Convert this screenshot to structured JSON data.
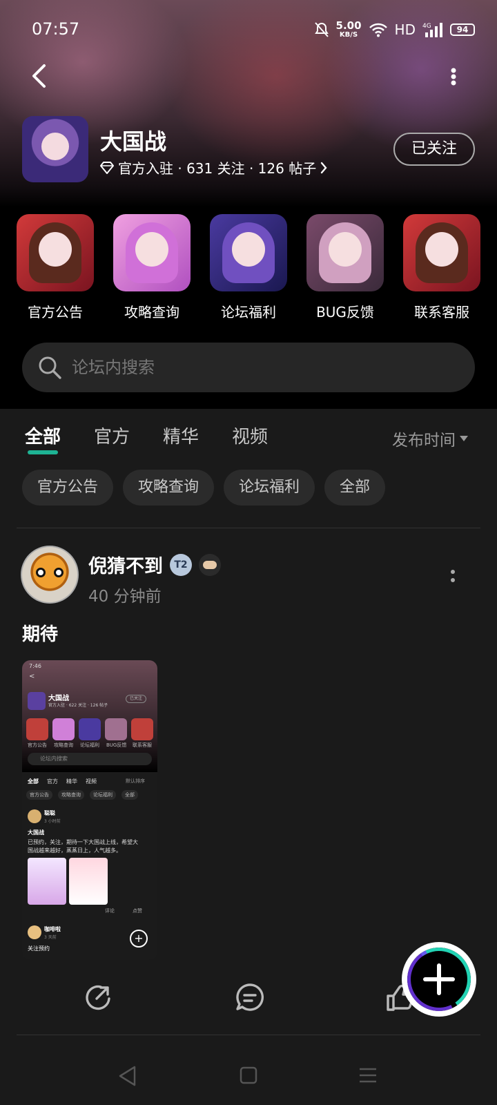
{
  "status_bar": {
    "time": "07:57",
    "net_speed_value": "5.00",
    "net_speed_unit": "KB/S",
    "hd": "HD",
    "network": "4G",
    "battery": "94"
  },
  "forum": {
    "title": "大国战",
    "meta": "官方入驻 · 631 关注 · 126 帖子",
    "follow_label": "已关注"
  },
  "shortcuts": [
    {
      "label": "官方公告",
      "icon": "forum-announcement-image"
    },
    {
      "label": "攻略查询",
      "icon": "strategy-image"
    },
    {
      "label": "论坛福利",
      "icon": "welfare-image"
    },
    {
      "label": "BUG反馈",
      "icon": "bug-feedback-image"
    },
    {
      "label": "联系客服",
      "icon": "customer-service-image"
    }
  ],
  "search": {
    "placeholder": "论坛内搜索"
  },
  "tabs": [
    {
      "label": "全部",
      "active": true
    },
    {
      "label": "官方",
      "active": false
    },
    {
      "label": "精华",
      "active": false
    },
    {
      "label": "视频",
      "active": false
    }
  ],
  "sort_label": "发布时间",
  "chips": [
    "官方公告",
    "攻略查询",
    "论坛福利",
    "全部"
  ],
  "post": {
    "author": "倪猜不到",
    "level_badge": "T2",
    "time": "40 分钟前",
    "content": "期待"
  },
  "thumbnail": {
    "time": "7:46",
    "title": "大国战",
    "meta": "官方入驻 · 622 关注 · 126 帖子",
    "follow": "已关注",
    "labels": [
      "官方公告",
      "攻略查询",
      "论坛福利",
      "BUG反馈",
      "联系客服"
    ],
    "search": "论坛内搜索",
    "tabs": [
      "全部",
      "官方",
      "精华",
      "视频"
    ],
    "sort": "默认排序",
    "chips": [
      "官方公告",
      "攻略查询",
      "论坛福利",
      "全部"
    ],
    "author": "聪聪",
    "author_time": "3 小时前",
    "post_title": "大国战",
    "post_text_1": "已预约，关注，期待一下大国战上线，希望大",
    "post_text_2": "国战越来越好，蒸蒸日上，人气越多。",
    "comment": "评论",
    "like": "点赞",
    "author2": "咖啡啦",
    "author2_time": "3 天前",
    "post2": "关注预约"
  },
  "colors": {
    "accent": "#1fc4a2",
    "background": "#1a1a1a",
    "chip_bg": "#2b2b2b"
  }
}
